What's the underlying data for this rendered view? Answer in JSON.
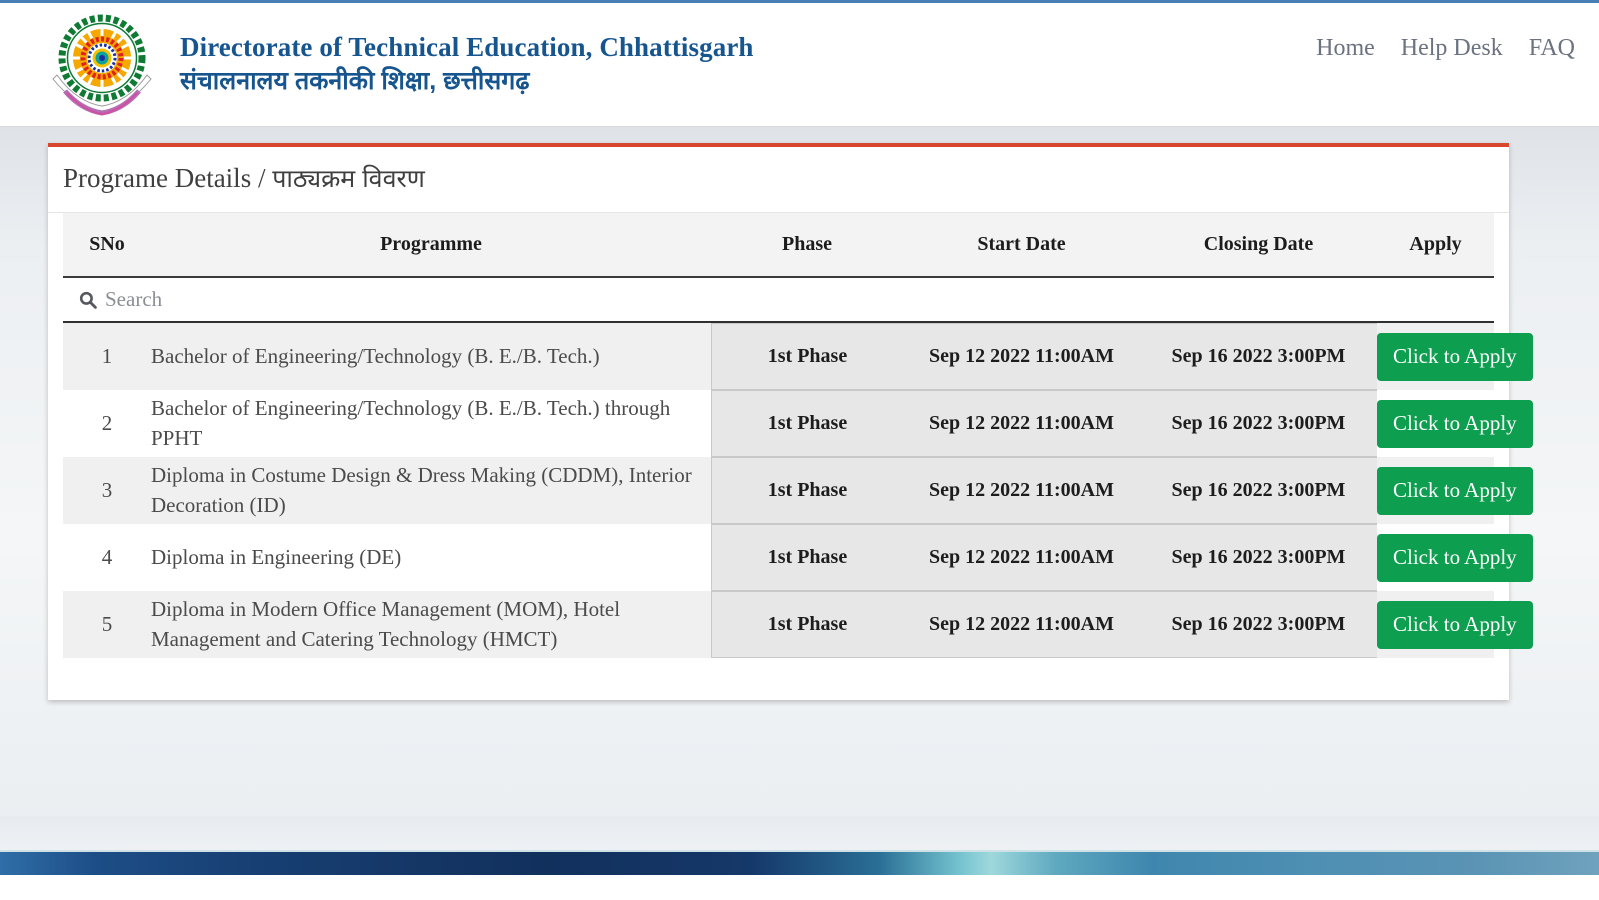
{
  "header": {
    "logo_alt": "Directorate of Technical Education Chhattisgarh emblem",
    "title_en": "Directorate of Technical Education, Chhattisgarh",
    "title_hi": "संचालनालय तकनीकी शिक्षा, छत्तीसगढ़",
    "nav": [
      {
        "label": "Home"
      },
      {
        "label": "Help Desk"
      },
      {
        "label": "FAQ"
      }
    ],
    "accent_color": "#17558f"
  },
  "card": {
    "title_en": "Programe Details / ",
    "title_hi": "पाठ्यक्रम विवरण",
    "accent_top_color": "#d9462e"
  },
  "table": {
    "columns": [
      "SNo",
      "Programme",
      "Phase",
      "Start Date",
      "Closing Date",
      "Apply"
    ],
    "search_placeholder": "Search",
    "rows": [
      {
        "sno": "1",
        "programme": "Bachelor of Engineering/Technology (B. E./B. Tech.)",
        "phase": "1st Phase",
        "start_date": "Sep 12 2022 11:00AM",
        "closing_date": "Sep 16 2022 3:00PM",
        "apply_label": "Click to Apply"
      },
      {
        "sno": "2",
        "programme": "Bachelor of Engineering/Technology (B. E./B. Tech.) through PPHT",
        "phase": "1st Phase",
        "start_date": "Sep 12 2022 11:00AM",
        "closing_date": "Sep 16 2022 3:00PM",
        "apply_label": "Click to Apply"
      },
      {
        "sno": "3",
        "programme": "Diploma in Costume Design & Dress Making (CDDM), Interior Decoration (ID)",
        "phase": "1st Phase",
        "start_date": "Sep 12 2022 11:00AM",
        "closing_date": "Sep 16 2022 3:00PM",
        "apply_label": "Click to Apply"
      },
      {
        "sno": "4",
        "programme": "Diploma in Engineering (DE)",
        "phase": "1st Phase",
        "start_date": "Sep 12 2022 11:00AM",
        "closing_date": "Sep 16 2022 3:00PM",
        "apply_label": "Click to Apply"
      },
      {
        "sno": "5",
        "programme": "Diploma in Modern Office Management (MOM), Hotel Management and Catering Technology (HMCT)",
        "phase": "1st Phase",
        "start_date": "Sep 12 2022 11:00AM",
        "closing_date": "Sep 16 2022 3:00PM",
        "apply_label": "Click to Apply"
      }
    ],
    "apply_button_color": "#0e9e4f"
  }
}
